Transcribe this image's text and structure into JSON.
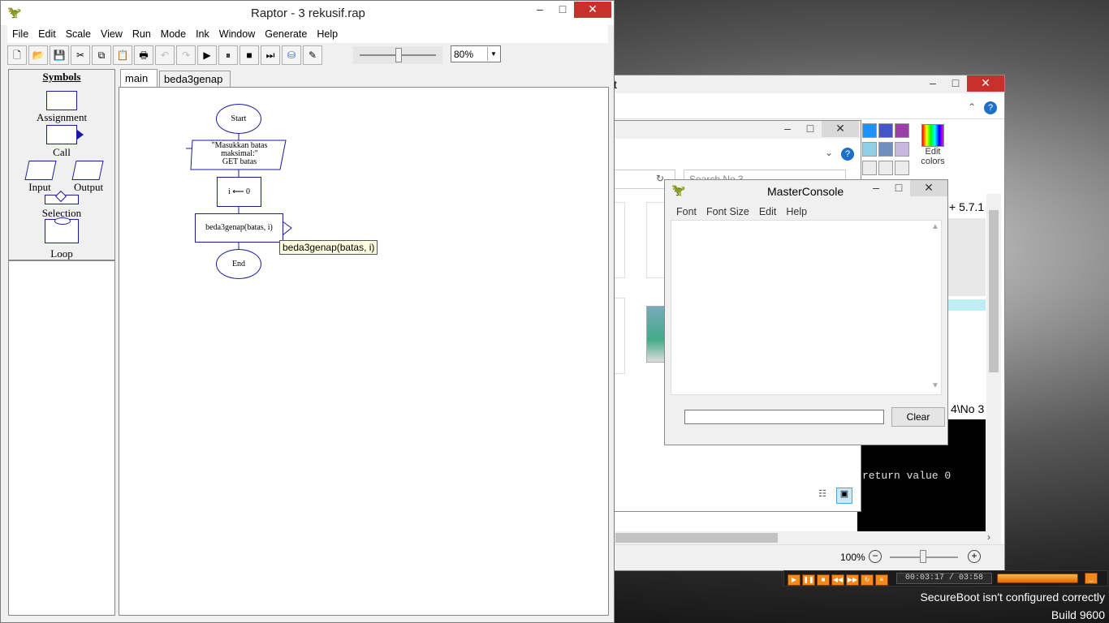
{
  "raptor": {
    "title": "Raptor - 3 rekusif.rap",
    "menu": [
      "File",
      "Edit",
      "Scale",
      "View",
      "Run",
      "Mode",
      "Ink",
      "Window",
      "Generate",
      "Help"
    ],
    "zoom": "80%",
    "symbols_title": "Symbols",
    "symbols": [
      "Assignment",
      "Call",
      "Input",
      "Output",
      "Selection",
      "Loop"
    ],
    "tabs": [
      "main",
      "beda3genap"
    ],
    "flow": {
      "start": "Start",
      "input_line1": "\"Masukkan batas",
      "input_line2": "maksimal:\"",
      "input_line3": "GET batas",
      "assign": "i ⟵ 0",
      "call": "beda3genap(batas, i)",
      "end": "End",
      "tooltip": "beda3genap(batas, i)"
    }
  },
  "console": {
    "title": "MasterConsole",
    "menu": [
      "Font",
      "Font Size",
      "Edit",
      "Help"
    ],
    "clear": "Clear"
  },
  "background": {
    "paint_label1": "Edit",
    "paint_label2": "colors",
    "version": "+ 5.7.1",
    "path": "4\\No 3",
    "return_text": "return value 0",
    "search_placeholder": "Search No 3",
    "zoom": "100%",
    "t_label": "t",
    "palette": [
      "#1e90ff",
      "#4455cc",
      "#9b3fa8",
      "#8fcfe8",
      "#6f8fc0",
      "#c8b8e0",
      "#ececec",
      "#ececec",
      "#ececec"
    ]
  },
  "player": {
    "time": "00:03:17 / 03:58"
  },
  "watermark": {
    "line1": "SecureBoot isn't configured correctly",
    "line2": "Build 9600"
  }
}
